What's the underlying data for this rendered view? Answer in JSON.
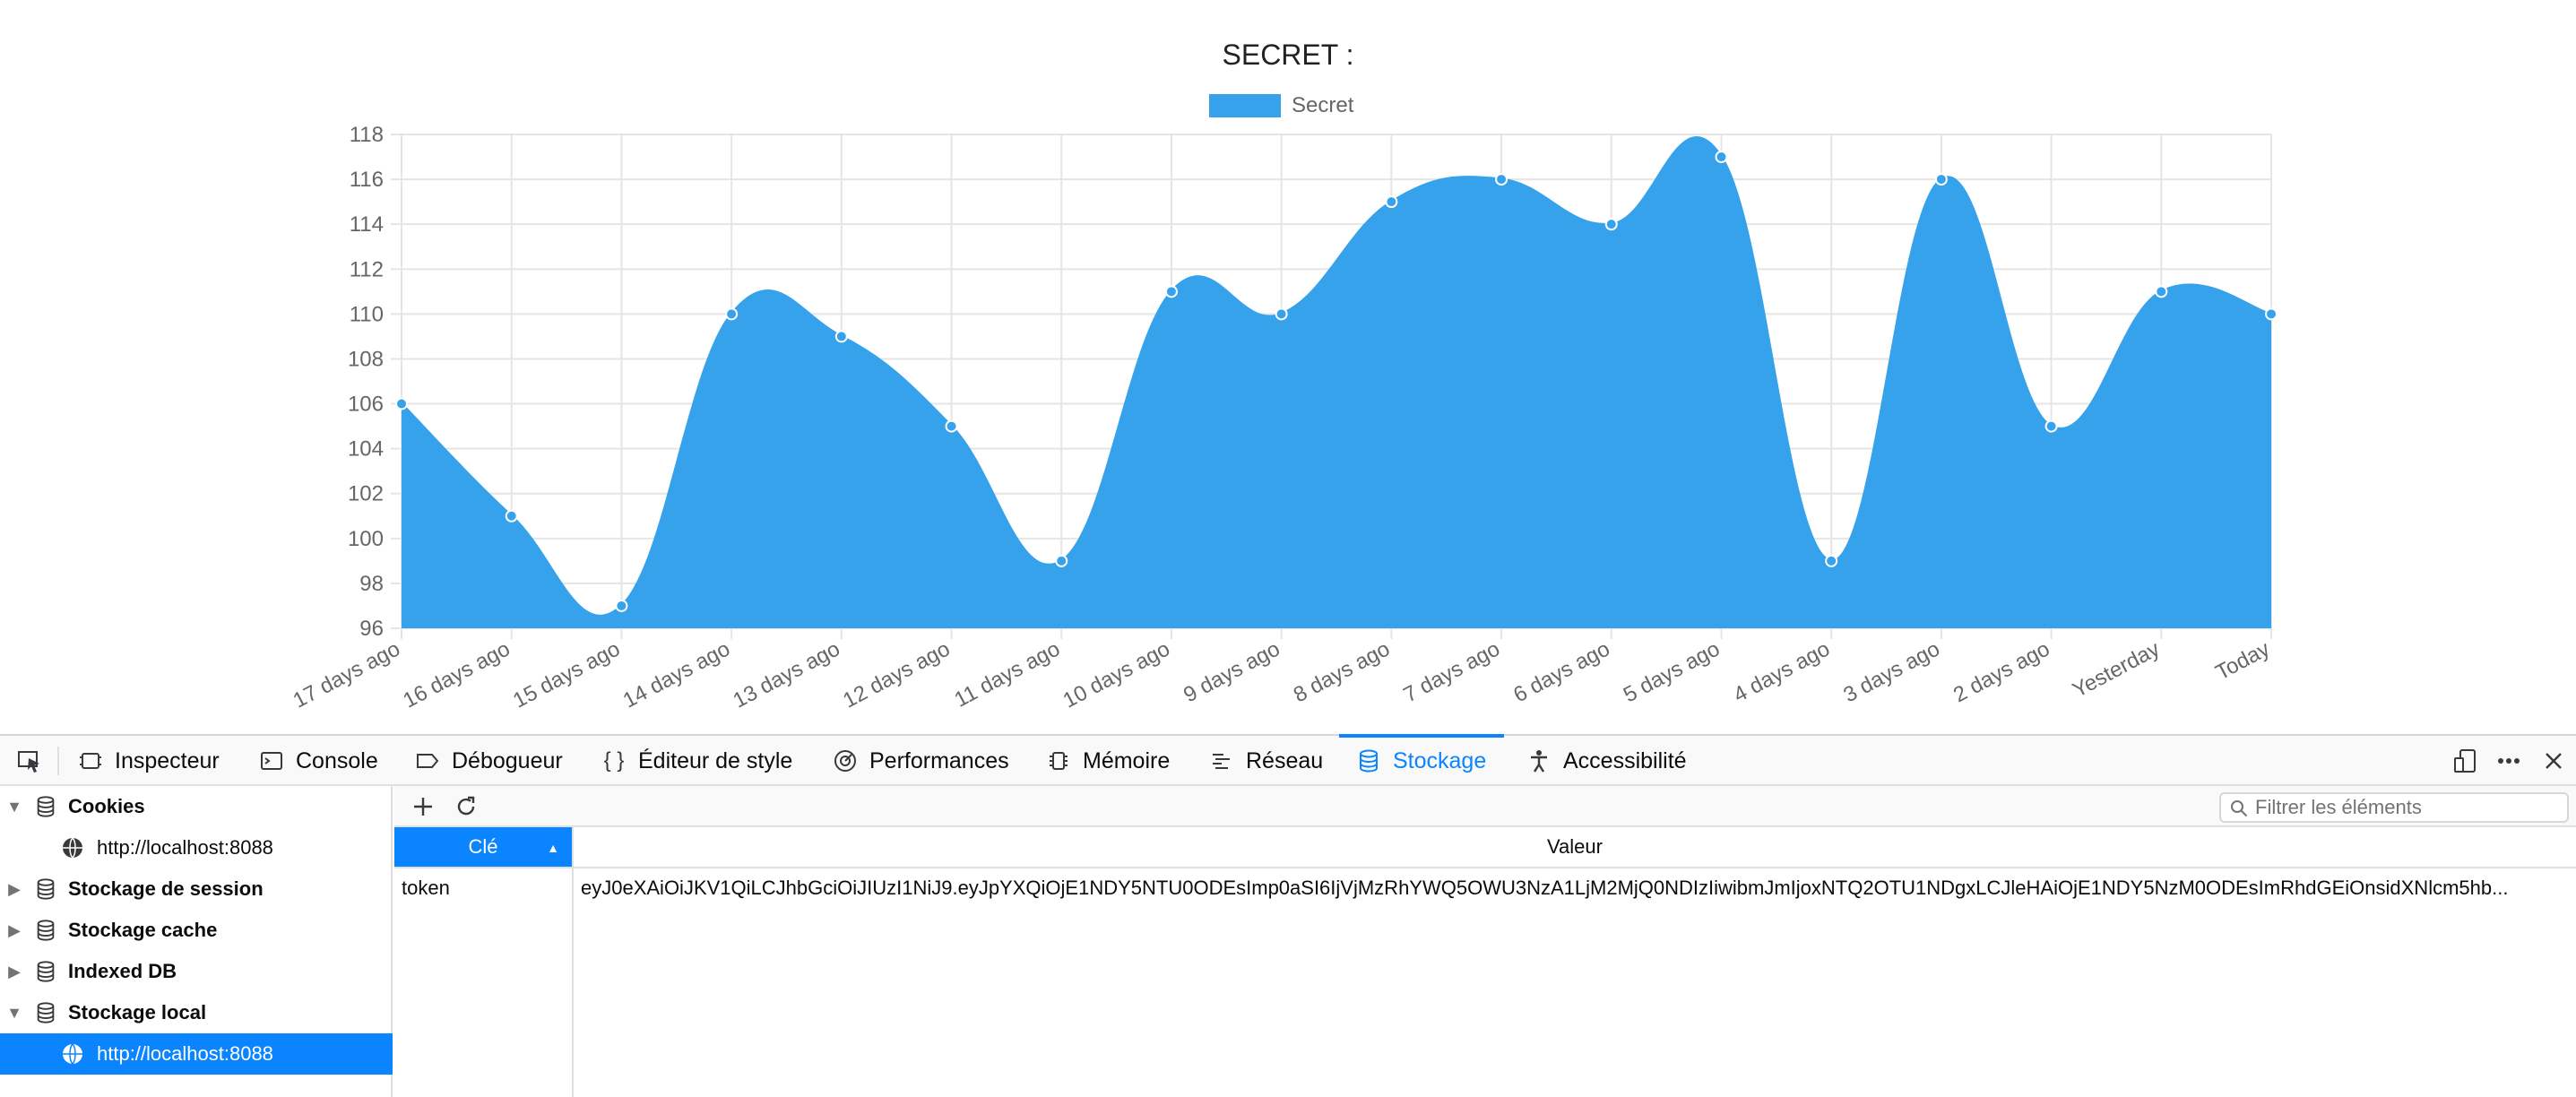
{
  "chart_data": {
    "type": "area",
    "title": "SECRET :",
    "legend": {
      "position": "top",
      "entries": [
        "Secret"
      ]
    },
    "categories": [
      "17 days ago",
      "16 days ago",
      "15 days ago",
      "14 days ago",
      "13 days ago",
      "12 days ago",
      "11 days ago",
      "10 days ago",
      "9 days ago",
      "8 days ago",
      "7 days ago",
      "6 days ago",
      "5 days ago",
      "4 days ago",
      "3 days ago",
      "2 days ago",
      "Yesterday",
      "Today"
    ],
    "series": [
      {
        "name": "Secret",
        "values": [
          106,
          101,
          97,
          110,
          109,
          105,
          99,
          111,
          110,
          115,
          116,
          114,
          117,
          99,
          116,
          105,
          111,
          110
        ]
      }
    ],
    "ylim": [
      96,
      118
    ],
    "yticks": [
      96,
      98,
      100,
      102,
      104,
      106,
      108,
      110,
      112,
      114,
      116,
      118
    ],
    "grid": true,
    "colors": {
      "fill": "#36a2eb",
      "point": "#36a2eb",
      "grid": "#e5e5e5",
      "axis_text": "#666666"
    }
  },
  "devtools": {
    "toolbar": {
      "picker_icon": "element-picker-icon",
      "tabs": [
        {
          "label": "Inspecteur",
          "icon": "inspector-icon"
        },
        {
          "label": "Console",
          "icon": "console-icon"
        },
        {
          "label": "Débogueur",
          "icon": "debugger-icon"
        },
        {
          "label": "Éditeur de style",
          "icon": "style-editor-icon"
        },
        {
          "label": "Performances",
          "icon": "performance-icon"
        },
        {
          "label": "Mémoire",
          "icon": "memory-icon"
        },
        {
          "label": "Réseau",
          "icon": "network-icon"
        },
        {
          "label": "Stockage",
          "icon": "storage-icon"
        },
        {
          "label": "Accessibilité",
          "icon": "accessibility-icon"
        }
      ],
      "selected_tab": "Stockage",
      "right_icons": [
        "responsive-design-icon",
        "more-options-icon",
        "close-icon"
      ]
    },
    "sidebar": {
      "items": [
        {
          "label": "Cookies",
          "expanded": true,
          "level": 0
        },
        {
          "label": "http://localhost:8088",
          "level": 1
        },
        {
          "label": "Stockage de session",
          "expanded": false,
          "level": 0
        },
        {
          "label": "Stockage cache",
          "expanded": false,
          "level": 0
        },
        {
          "label": "Indexed DB",
          "expanded": false,
          "level": 0
        },
        {
          "label": "Stockage local",
          "expanded": true,
          "level": 0
        },
        {
          "label": "http://localhost:8088",
          "level": 1,
          "selected": true
        }
      ]
    },
    "storage": {
      "add_icon": "add-icon",
      "refresh_icon": "refresh-icon",
      "filter_placeholder": "Filtrer les éléments",
      "columns": [
        "Clé",
        "Valeur"
      ],
      "sorted_column": "Clé",
      "rows": [
        {
          "key": "token",
          "value": "eyJ0eXAiOiJKV1QiLCJhbGciOiJIUzI1NiJ9.eyJpYXQiOjE1NDY5NTU0ODEsImp0aSI6IjVjMzRhYWQ5OWU3NzA1LjM2MjQ0NDIzIiwibmJmIjoxNTQ2OTU1NDgxLCJleHAiOjE1NDY5NzM0ODEsImRhdGEiOnsidXNlcm5hb..."
        }
      ]
    }
  }
}
